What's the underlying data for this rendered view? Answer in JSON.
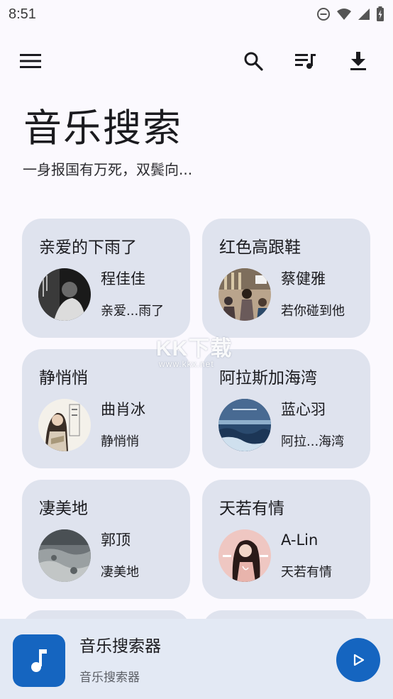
{
  "status_bar": {
    "time": "8:51",
    "icons": [
      "do-not-disturb-icon",
      "wifi-icon",
      "signal-icon",
      "battery-charging-icon"
    ]
  },
  "toolbar": {
    "icons": [
      "menu-icon",
      "search-icon",
      "playlist-icon",
      "download-icon"
    ]
  },
  "header": {
    "title": "音乐搜索",
    "subtitle": "一身报国有万死，双鬓向..."
  },
  "songs": [
    {
      "title": "亲爱的下雨了",
      "artist": "程佳佳",
      "album": "亲爱...雨了"
    },
    {
      "title": "红色高跟鞋",
      "artist": "蔡健雅",
      "album": "若你碰到他"
    },
    {
      "title": "静悄悄",
      "artist": "曲肖冰",
      "album": "静悄悄"
    },
    {
      "title": "阿拉斯加海湾",
      "artist": "蓝心羽",
      "album": "阿拉...海湾"
    },
    {
      "title": "凄美地",
      "artist": "郭顶",
      "album": "凄美地"
    },
    {
      "title": "天若有情",
      "artist": "A-Lin",
      "album": "天若有情"
    }
  ],
  "watermark": {
    "brand": "KK下载",
    "url": "www.kkx.net"
  },
  "player": {
    "title": "音乐搜索器",
    "subtitle": "音乐搜索器",
    "icons": [
      "music-note-icon",
      "play-icon"
    ]
  },
  "colors": {
    "accent": "#1565c0",
    "card_background": "#dfe3ee",
    "page_background": "#fbf9fe",
    "player_background": "#e3e9f4"
  }
}
